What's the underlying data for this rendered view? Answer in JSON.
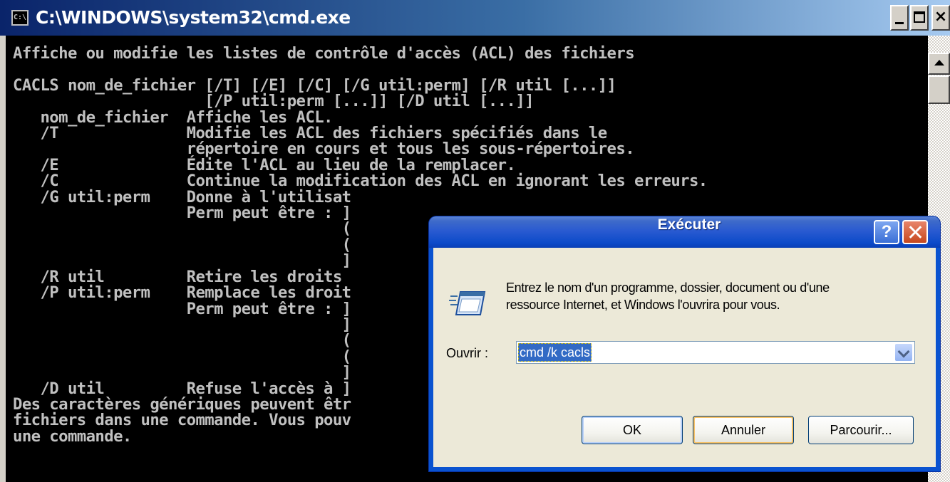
{
  "cmd": {
    "title": "C:\\WINDOWS\\system32\\cmd.exe",
    "app_icon": "C:\\",
    "console_lines": [
      "Affiche ou modifie les listes de contrôle d'accès (ACL) des fichiers",
      "",
      "CACLS nom_de_fichier [/T] [/E] [/C] [/G util:perm] [/R util [...]]",
      "                     [/P util:perm [...]] [/D util [...]]",
      "   nom_de_fichier  Affiche les ACL.",
      "   /T              Modifie les ACL des fichiers spécifiés dans le",
      "                   répertoire en cours et tous les sous-répertoires.",
      "   /E              Édite l'ACL au lieu de la remplacer.",
      "   /C              Continue la modification des ACL en ignorant les erreurs.",
      "   /G util:perm    Donne à l'utilisat",
      "                   Perm peut être : ]",
      "                                    (",
      "                                    (",
      "                                    ]",
      "   /R util         Retire les droits",
      "   /P util:perm    Remplace les droit",
      "                   Perm peut être : ]",
      "                                    ]",
      "                                    (",
      "                                    (",
      "                                    ]",
      "   /D util         Refuse l'accès à ]",
      "Des caractères génériques peuvent êtr",
      "fichiers dans une commande. Vous pouv",
      "une commande."
    ]
  },
  "run_dialog": {
    "title": "Exécuter",
    "help_label": "?",
    "message_line1": "Entrez le nom d'un programme, dossier, document ou d'une",
    "message_line2": "ressource Internet, et Windows l'ouvrira pour vous.",
    "open_label": "Ouvrir :",
    "open_value": "cmd /k cacls",
    "ok_label": "OK",
    "cancel_label": "Annuler",
    "browse_label": "Parcourir..."
  }
}
